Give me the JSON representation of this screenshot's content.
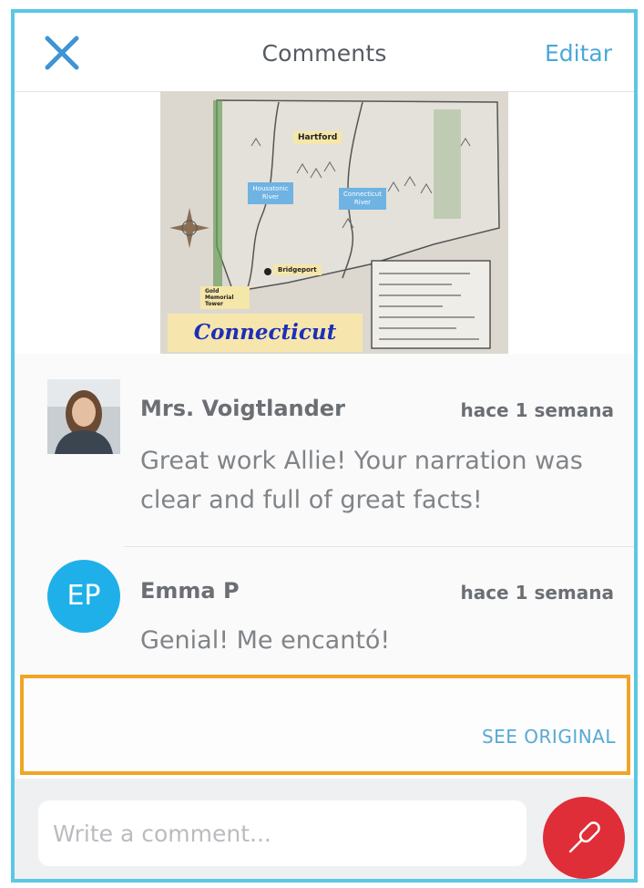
{
  "header": {
    "title": "Comments",
    "edit_label": "Editar",
    "close_icon": "close-icon"
  },
  "media": {
    "caption": "Connecticut",
    "labels": {
      "hartford": "Hartford",
      "bridgeport": "Bridgeport",
      "river_west": "Housatonic River",
      "river_east": "Connecticut River",
      "gold_star": "Gold Memorial Tower"
    }
  },
  "comments": [
    {
      "author": "Mrs. Voigtlander",
      "time": "hace 1 semana",
      "text": "Great work Allie! Your narration was clear and full of great facts!",
      "avatar": "photo"
    },
    {
      "author": "Emma P",
      "time": "hace 1 semana",
      "text": "Genial! Me encantó!",
      "avatar_initials": "EP",
      "avatar_color": "#1fb0ea"
    }
  ],
  "translation": {
    "see_original_label": "SEE ORIGINAL"
  },
  "composer": {
    "placeholder": "Write a comment...",
    "mic_icon": "microphone-icon",
    "mic_color": "#df2e38"
  },
  "colors": {
    "frame": "#5bc7e3",
    "accent_link": "#4aa9d9",
    "highlight_border": "#f0a526"
  }
}
